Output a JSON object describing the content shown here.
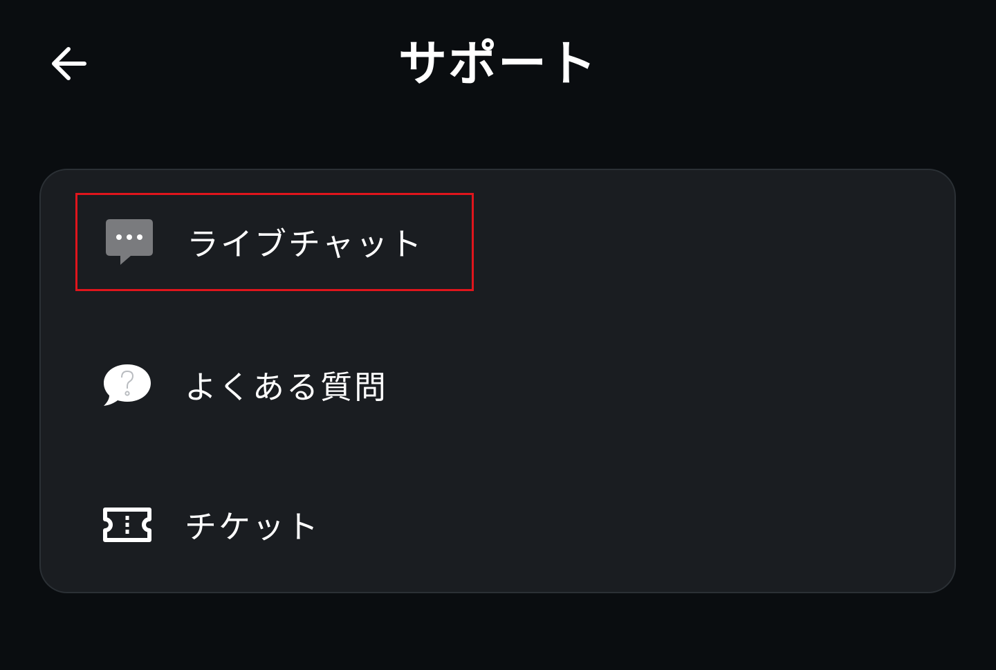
{
  "header": {
    "back_icon": "arrow-left-icon",
    "title": "サポート"
  },
  "menu": {
    "items": [
      {
        "label": "ライブチャット",
        "icon": "chat-bubble-dots-icon",
        "highlighted": true
      },
      {
        "label": "よくある質問",
        "icon": "question-speech-bubble-icon",
        "highlighted": false
      },
      {
        "label": "チケット",
        "icon": "ticket-icon",
        "highlighted": false
      }
    ]
  },
  "colors": {
    "background": "#0a0d10",
    "card_background": "#1a1d21",
    "card_border": "#2b3035",
    "text": "#ffffff",
    "chat_icon": "#7a7b7e",
    "highlight_border": "#e0151c"
  }
}
